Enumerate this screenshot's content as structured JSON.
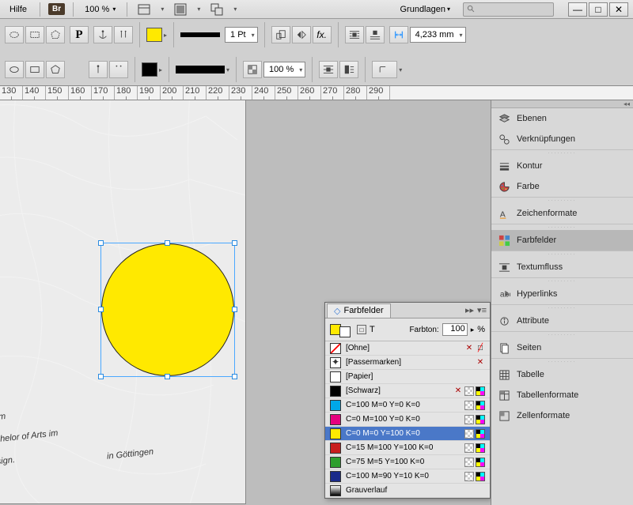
{
  "menubar": {
    "help": "Hilfe",
    "br": "Br",
    "zoom": "100 %",
    "workspace": "Grundlagen"
  },
  "toolbar": {
    "stroke_weight": "1 Pt",
    "opacity": "100 %",
    "distance": "4,233 mm"
  },
  "ruler_start": 130,
  "ruler_step": 10,
  "ruler_count": 17,
  "document_text": {
    "l1": "eig A-Plus am",
    "l2": "Grades Bachelor of Arts im",
    "l3": "on und Design.",
    "l4": "in Göttingen"
  },
  "farbfelder": {
    "title": "Farbfelder",
    "tint_label": "Farbton:",
    "tint_value": "100",
    "tint_unit": "%",
    "swatches": [
      {
        "name": "[Ohne]",
        "chip": "none",
        "locked": true,
        "nodel": true
      },
      {
        "name": "[Passermarken]",
        "chip": "reg",
        "locked": true,
        "cmyk": false
      },
      {
        "name": "[Papier]",
        "color": "#ffffff"
      },
      {
        "name": "[Schwarz]",
        "color": "#000000",
        "locked": true,
        "cmyk": true
      },
      {
        "name": "C=100 M=0 Y=0 K=0",
        "color": "#00a8e8",
        "cmyk": true
      },
      {
        "name": "C=0 M=100 Y=0 K=0",
        "color": "#e6007e",
        "cmyk": true
      },
      {
        "name": "C=0 M=0 Y=100 K=0",
        "color": "#ffe900",
        "cmyk": true,
        "selected": true
      },
      {
        "name": "C=15 M=100 Y=100 K=0",
        "color": "#c81e1e",
        "cmyk": true
      },
      {
        "name": "C=75 M=5 Y=100 K=0",
        "color": "#2e9e2e",
        "cmyk": true
      },
      {
        "name": "C=100 M=90 Y=10 K=0",
        "color": "#1a2a8a",
        "cmyk": true
      },
      {
        "name": "Grauverlauf",
        "chip": "gradient"
      }
    ]
  },
  "dock": [
    {
      "label": "Ebenen",
      "icon": "layers"
    },
    {
      "label": "Verknüpfungen",
      "icon": "links"
    },
    {
      "sep": true
    },
    {
      "label": "Kontur",
      "icon": "stroke"
    },
    {
      "label": "Farbe",
      "icon": "color"
    },
    {
      "sep": true
    },
    {
      "label": "Zeichenformate",
      "icon": "charstyle"
    },
    {
      "sep": true
    },
    {
      "label": "Farbfelder",
      "icon": "swatches",
      "active": true
    },
    {
      "sep": true
    },
    {
      "label": "Textumfluss",
      "icon": "wrap"
    },
    {
      "sep": true
    },
    {
      "label": "Hyperlinks",
      "icon": "hyperlinks"
    },
    {
      "sep": true
    },
    {
      "label": "Attribute",
      "icon": "attr"
    },
    {
      "sep": true
    },
    {
      "label": "Seiten",
      "icon": "pages"
    },
    {
      "sep": true
    },
    {
      "label": "Tabelle",
      "icon": "table"
    },
    {
      "label": "Tabellenformate",
      "icon": "tablefmt"
    },
    {
      "label": "Zellenformate",
      "icon": "cellfmt"
    }
  ]
}
